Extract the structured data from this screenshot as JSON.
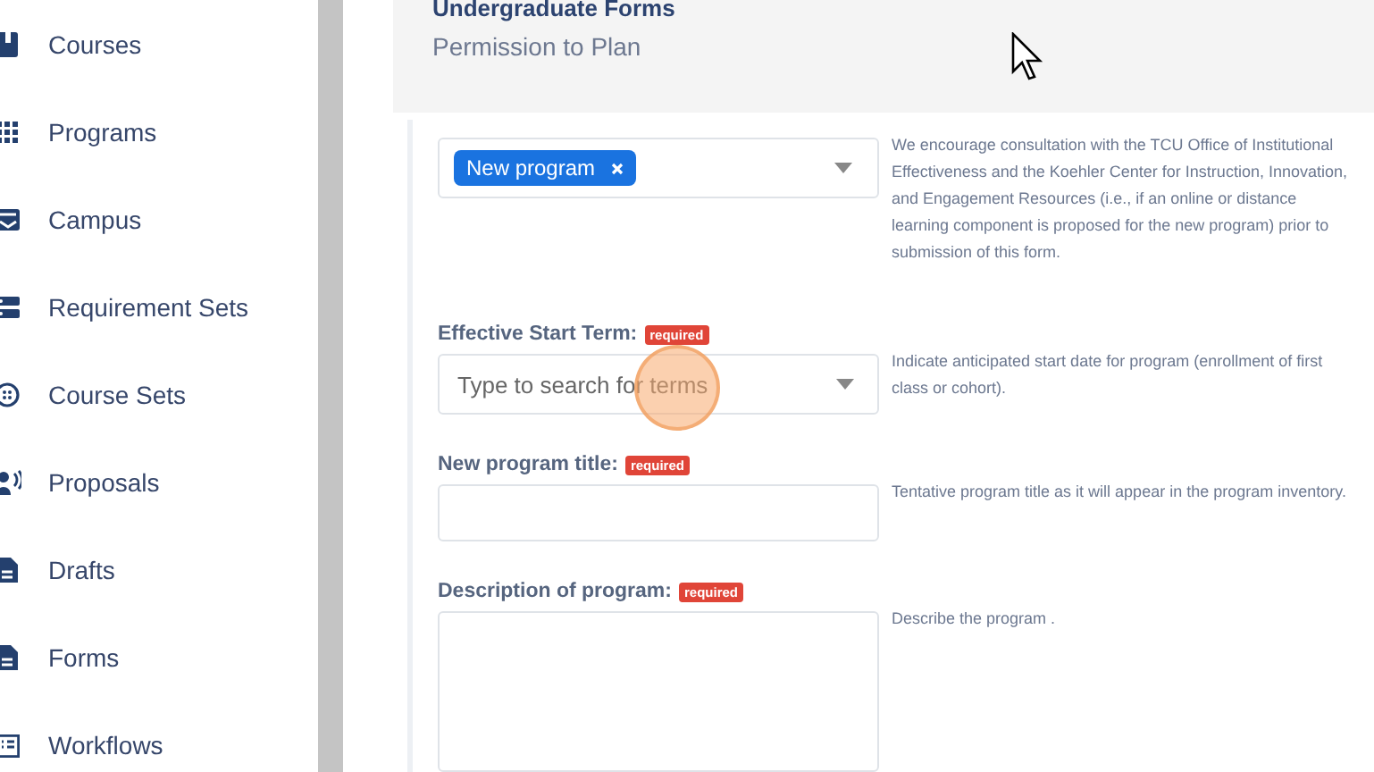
{
  "sidebar": {
    "items": [
      {
        "label": "Courses",
        "kind": "book"
      },
      {
        "label": "Programs",
        "kind": "grid"
      },
      {
        "label": "Campus",
        "kind": "inbox"
      },
      {
        "label": "Requirement Sets",
        "kind": "server"
      },
      {
        "label": "Course Sets",
        "kind": "circle"
      },
      {
        "label": "Proposals",
        "kind": "speaker"
      },
      {
        "label": "Drafts",
        "kind": "doc"
      },
      {
        "label": "Forms",
        "kind": "doc"
      },
      {
        "label": "Workflows",
        "kind": "list"
      }
    ]
  },
  "header": {
    "title": "Undergraduate Forms",
    "subtitle": "Permission to Plan"
  },
  "fields": [
    {
      "kind": "tags",
      "tags": [
        "New program"
      ],
      "help": "We encourage consultation with the TCU Office of Institutional Effectiveness and the Koehler Center for Instruction, Innovation, and Engagement Resources (i.e., if an online or distance learning component is proposed for the new program) prior to submission of this form."
    },
    {
      "kind": "select",
      "label": "Effective Start Term:",
      "badge": "required",
      "placeholder": "Type to search for terms",
      "help": "Indicate anticipated start date for program (enrollment of first class or cohort)."
    },
    {
      "kind": "text",
      "label": "New program title:",
      "badge": "required",
      "help": "Tentative program title as it will appear in the program inventory."
    },
    {
      "kind": "textarea",
      "label": "Description of program:",
      "badge": "required",
      "help": "Describe the program ."
    }
  ]
}
